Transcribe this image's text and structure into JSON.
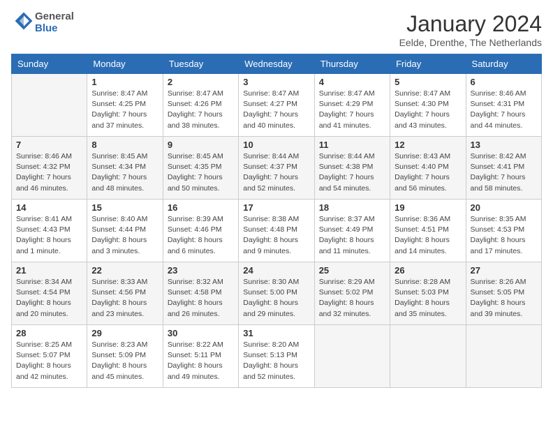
{
  "header": {
    "logo_line1": "General",
    "logo_line2": "Blue",
    "month_title": "January 2024",
    "subtitle": "Eelde, Drenthe, The Netherlands"
  },
  "weekdays": [
    "Sunday",
    "Monday",
    "Tuesday",
    "Wednesday",
    "Thursday",
    "Friday",
    "Saturday"
  ],
  "weeks": [
    [
      {
        "day": "",
        "info": ""
      },
      {
        "day": "1",
        "info": "Sunrise: 8:47 AM\nSunset: 4:25 PM\nDaylight: 7 hours\nand 37 minutes."
      },
      {
        "day": "2",
        "info": "Sunrise: 8:47 AM\nSunset: 4:26 PM\nDaylight: 7 hours\nand 38 minutes."
      },
      {
        "day": "3",
        "info": "Sunrise: 8:47 AM\nSunset: 4:27 PM\nDaylight: 7 hours\nand 40 minutes."
      },
      {
        "day": "4",
        "info": "Sunrise: 8:47 AM\nSunset: 4:29 PM\nDaylight: 7 hours\nand 41 minutes."
      },
      {
        "day": "5",
        "info": "Sunrise: 8:47 AM\nSunset: 4:30 PM\nDaylight: 7 hours\nand 43 minutes."
      },
      {
        "day": "6",
        "info": "Sunrise: 8:46 AM\nSunset: 4:31 PM\nDaylight: 7 hours\nand 44 minutes."
      }
    ],
    [
      {
        "day": "7",
        "info": "Sunrise: 8:46 AM\nSunset: 4:32 PM\nDaylight: 7 hours\nand 46 minutes."
      },
      {
        "day": "8",
        "info": "Sunrise: 8:45 AM\nSunset: 4:34 PM\nDaylight: 7 hours\nand 48 minutes."
      },
      {
        "day": "9",
        "info": "Sunrise: 8:45 AM\nSunset: 4:35 PM\nDaylight: 7 hours\nand 50 minutes."
      },
      {
        "day": "10",
        "info": "Sunrise: 8:44 AM\nSunset: 4:37 PM\nDaylight: 7 hours\nand 52 minutes."
      },
      {
        "day": "11",
        "info": "Sunrise: 8:44 AM\nSunset: 4:38 PM\nDaylight: 7 hours\nand 54 minutes."
      },
      {
        "day": "12",
        "info": "Sunrise: 8:43 AM\nSunset: 4:40 PM\nDaylight: 7 hours\nand 56 minutes."
      },
      {
        "day": "13",
        "info": "Sunrise: 8:42 AM\nSunset: 4:41 PM\nDaylight: 7 hours\nand 58 minutes."
      }
    ],
    [
      {
        "day": "14",
        "info": "Sunrise: 8:41 AM\nSunset: 4:43 PM\nDaylight: 8 hours\nand 1 minute."
      },
      {
        "day": "15",
        "info": "Sunrise: 8:40 AM\nSunset: 4:44 PM\nDaylight: 8 hours\nand 3 minutes."
      },
      {
        "day": "16",
        "info": "Sunrise: 8:39 AM\nSunset: 4:46 PM\nDaylight: 8 hours\nand 6 minutes."
      },
      {
        "day": "17",
        "info": "Sunrise: 8:38 AM\nSunset: 4:48 PM\nDaylight: 8 hours\nand 9 minutes."
      },
      {
        "day": "18",
        "info": "Sunrise: 8:37 AM\nSunset: 4:49 PM\nDaylight: 8 hours\nand 11 minutes."
      },
      {
        "day": "19",
        "info": "Sunrise: 8:36 AM\nSunset: 4:51 PM\nDaylight: 8 hours\nand 14 minutes."
      },
      {
        "day": "20",
        "info": "Sunrise: 8:35 AM\nSunset: 4:53 PM\nDaylight: 8 hours\nand 17 minutes."
      }
    ],
    [
      {
        "day": "21",
        "info": "Sunrise: 8:34 AM\nSunset: 4:54 PM\nDaylight: 8 hours\nand 20 minutes."
      },
      {
        "day": "22",
        "info": "Sunrise: 8:33 AM\nSunset: 4:56 PM\nDaylight: 8 hours\nand 23 minutes."
      },
      {
        "day": "23",
        "info": "Sunrise: 8:32 AM\nSunset: 4:58 PM\nDaylight: 8 hours\nand 26 minutes."
      },
      {
        "day": "24",
        "info": "Sunrise: 8:30 AM\nSunset: 5:00 PM\nDaylight: 8 hours\nand 29 minutes."
      },
      {
        "day": "25",
        "info": "Sunrise: 8:29 AM\nSunset: 5:02 PM\nDaylight: 8 hours\nand 32 minutes."
      },
      {
        "day": "26",
        "info": "Sunrise: 8:28 AM\nSunset: 5:03 PM\nDaylight: 8 hours\nand 35 minutes."
      },
      {
        "day": "27",
        "info": "Sunrise: 8:26 AM\nSunset: 5:05 PM\nDaylight: 8 hours\nand 39 minutes."
      }
    ],
    [
      {
        "day": "28",
        "info": "Sunrise: 8:25 AM\nSunset: 5:07 PM\nDaylight: 8 hours\nand 42 minutes."
      },
      {
        "day": "29",
        "info": "Sunrise: 8:23 AM\nSunset: 5:09 PM\nDaylight: 8 hours\nand 45 minutes."
      },
      {
        "day": "30",
        "info": "Sunrise: 8:22 AM\nSunset: 5:11 PM\nDaylight: 8 hours\nand 49 minutes."
      },
      {
        "day": "31",
        "info": "Sunrise: 8:20 AM\nSunset: 5:13 PM\nDaylight: 8 hours\nand 52 minutes."
      },
      {
        "day": "",
        "info": ""
      },
      {
        "day": "",
        "info": ""
      },
      {
        "day": "",
        "info": ""
      }
    ]
  ]
}
